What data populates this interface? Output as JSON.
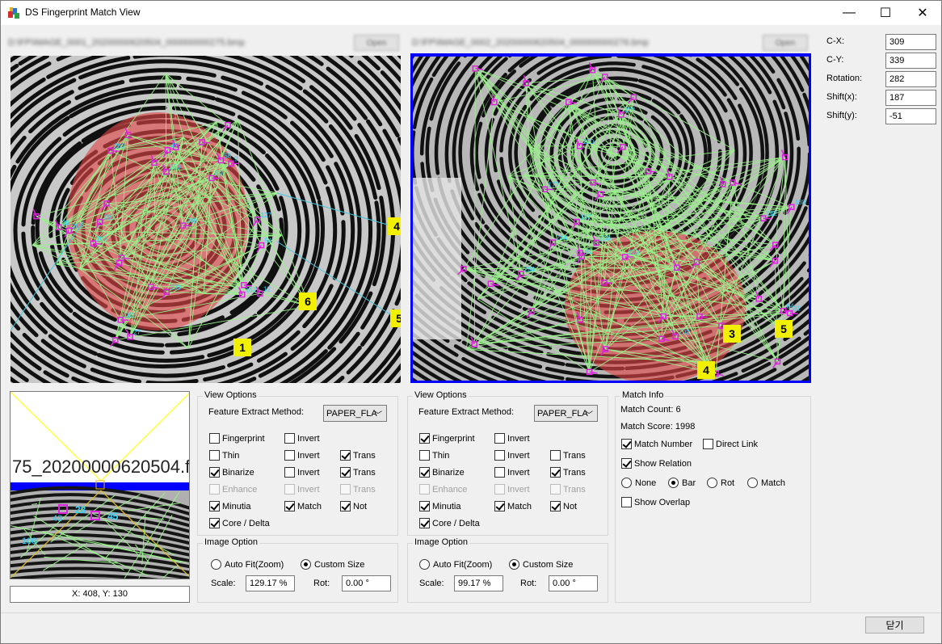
{
  "window": {
    "title": "DS Fingerprint Match View",
    "minimize": "—",
    "maximize": "☐",
    "close": "✕"
  },
  "left_path": {
    "text": "D:\\FP\\IMAGE_0001_20200000620504_000000000275.bmp",
    "button": "Open"
  },
  "right_path": {
    "text": "D:\\FP\\IMAGE_0002_20200000620504_000000000276.bmp",
    "button": "Open"
  },
  "left_pane": {
    "match_labels": [
      "1",
      "4",
      "5",
      "6"
    ],
    "minutia_ids": [
      "9",
      "110",
      "12",
      "69",
      "47",
      "58",
      "249",
      "54",
      "27",
      "100",
      "127",
      "250",
      "201",
      "233",
      "36",
      "207",
      "208",
      "162"
    ]
  },
  "right_pane": {
    "match_labels": [
      "3",
      "4",
      "5"
    ],
    "minutia_ids": [
      "229",
      "244",
      "277",
      "177",
      "188",
      "202",
      "162",
      "187",
      "250",
      "84",
      "61",
      "120",
      "31",
      "204"
    ]
  },
  "thumbnail": {
    "text": "75_20200000620504.fc",
    "coords": "X: 408, Y: 130",
    "ids": [
      "28",
      "45",
      "43",
      "108"
    ]
  },
  "transform": {
    "cx_label": "C-X:",
    "cx": "309",
    "cy_label": "C-Y:",
    "cy": "339",
    "rot_label": "Rotation:",
    "rot": "282",
    "sx_label": "Shift(x):",
    "sx": "187",
    "sy_label": "Shift(y):",
    "sy": "-51"
  },
  "left_view": {
    "legend": "View Options",
    "method_label": "Feature Extract Method:",
    "method": "PAPER_FLA",
    "rows": [
      {
        "a": "Fingerprint",
        "b": "Invert",
        "c": ""
      },
      {
        "a": "Thin",
        "b": "Invert",
        "c": "Trans"
      },
      {
        "a": "Binarize",
        "b": "Invert",
        "c": "Trans"
      },
      {
        "a": "Enhance",
        "b": "Invert",
        "c": "Trans"
      },
      {
        "a": "Minutia",
        "b": "Match",
        "c": "Not"
      },
      {
        "a": "Core / Delta"
      }
    ]
  },
  "right_view": {
    "legend": "View Options",
    "method_label": "Feature Extract Method:",
    "method": "PAPER_FLA",
    "rows": [
      {
        "a": "Fingerprint",
        "b": "Invert",
        "c": ""
      },
      {
        "a": "Thin",
        "b": "Invert",
        "c": "Trans"
      },
      {
        "a": "Binarize",
        "b": "Invert",
        "c": "Trans"
      },
      {
        "a": "Enhance",
        "b": "Invert",
        "c": "Trans"
      },
      {
        "a": "Minutia",
        "b": "Match",
        "c": "Not"
      },
      {
        "a": "Core / Delta"
      }
    ]
  },
  "left_image": {
    "legend": "Image Option",
    "auto": "Auto Fit(Zoom)",
    "custom": "Custom Size",
    "scale_label": "Scale:",
    "scale": "129.17 %",
    "rot_label": "Rot:",
    "rot": "0.00 °"
  },
  "right_image": {
    "legend": "Image Option",
    "auto": "Auto Fit(Zoom)",
    "custom": "Custom Size",
    "scale_label": "Scale:",
    "scale": "99.17 %",
    "rot_label": "Rot:",
    "rot": "0.00 °"
  },
  "match_info": {
    "legend": "Match Info",
    "count": "Match Count: 6",
    "score": "Match Score: 1998",
    "match_number": "Match Number",
    "direct_link": "Direct Link",
    "show_relation": "Show Relation",
    "none": "None",
    "bar": "Bar",
    "rot": "Rot",
    "match": "Match",
    "show_overlap": "Show Overlap"
  },
  "footer": {
    "close": "닫기"
  },
  "colors": {
    "match_line": "#98f08a",
    "minutia": "#e020e0",
    "label_bg": "#f0f000",
    "selection": "#0000ff",
    "relation": "#40c8e0"
  }
}
